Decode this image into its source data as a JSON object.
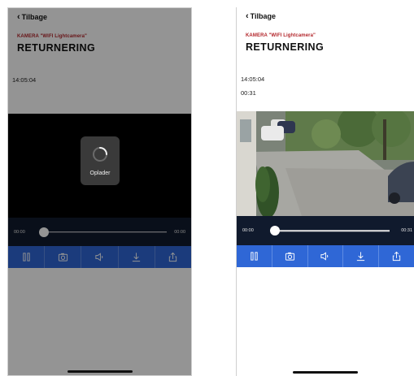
{
  "left_screen": {
    "back_label": "Tilbage",
    "camera_label": "KAMERA \"WIFI Lightcamera\"",
    "title": "RETURNERING",
    "timestamp": "14:05:04",
    "loader_text": "Oplader",
    "timeline": {
      "start": "00:00",
      "end": "00:00"
    }
  },
  "right_screen": {
    "back_label": "Tilbage",
    "camera_label": "KAMERA \"WIFI Lightcamera\"",
    "title": "RETURNERING",
    "timestamp": "14:05:04",
    "duration": "00:31",
    "timeline": {
      "start": "00:00",
      "end": "00:31"
    }
  },
  "toolbar_icons": [
    "pause-icon",
    "camera-icon",
    "speaker-icon",
    "download-icon",
    "share-icon"
  ],
  "colors": {
    "accent_red": "#b3262b",
    "toolbar_blue": "#2f67d6",
    "timeline_dark": "#101a2d"
  }
}
